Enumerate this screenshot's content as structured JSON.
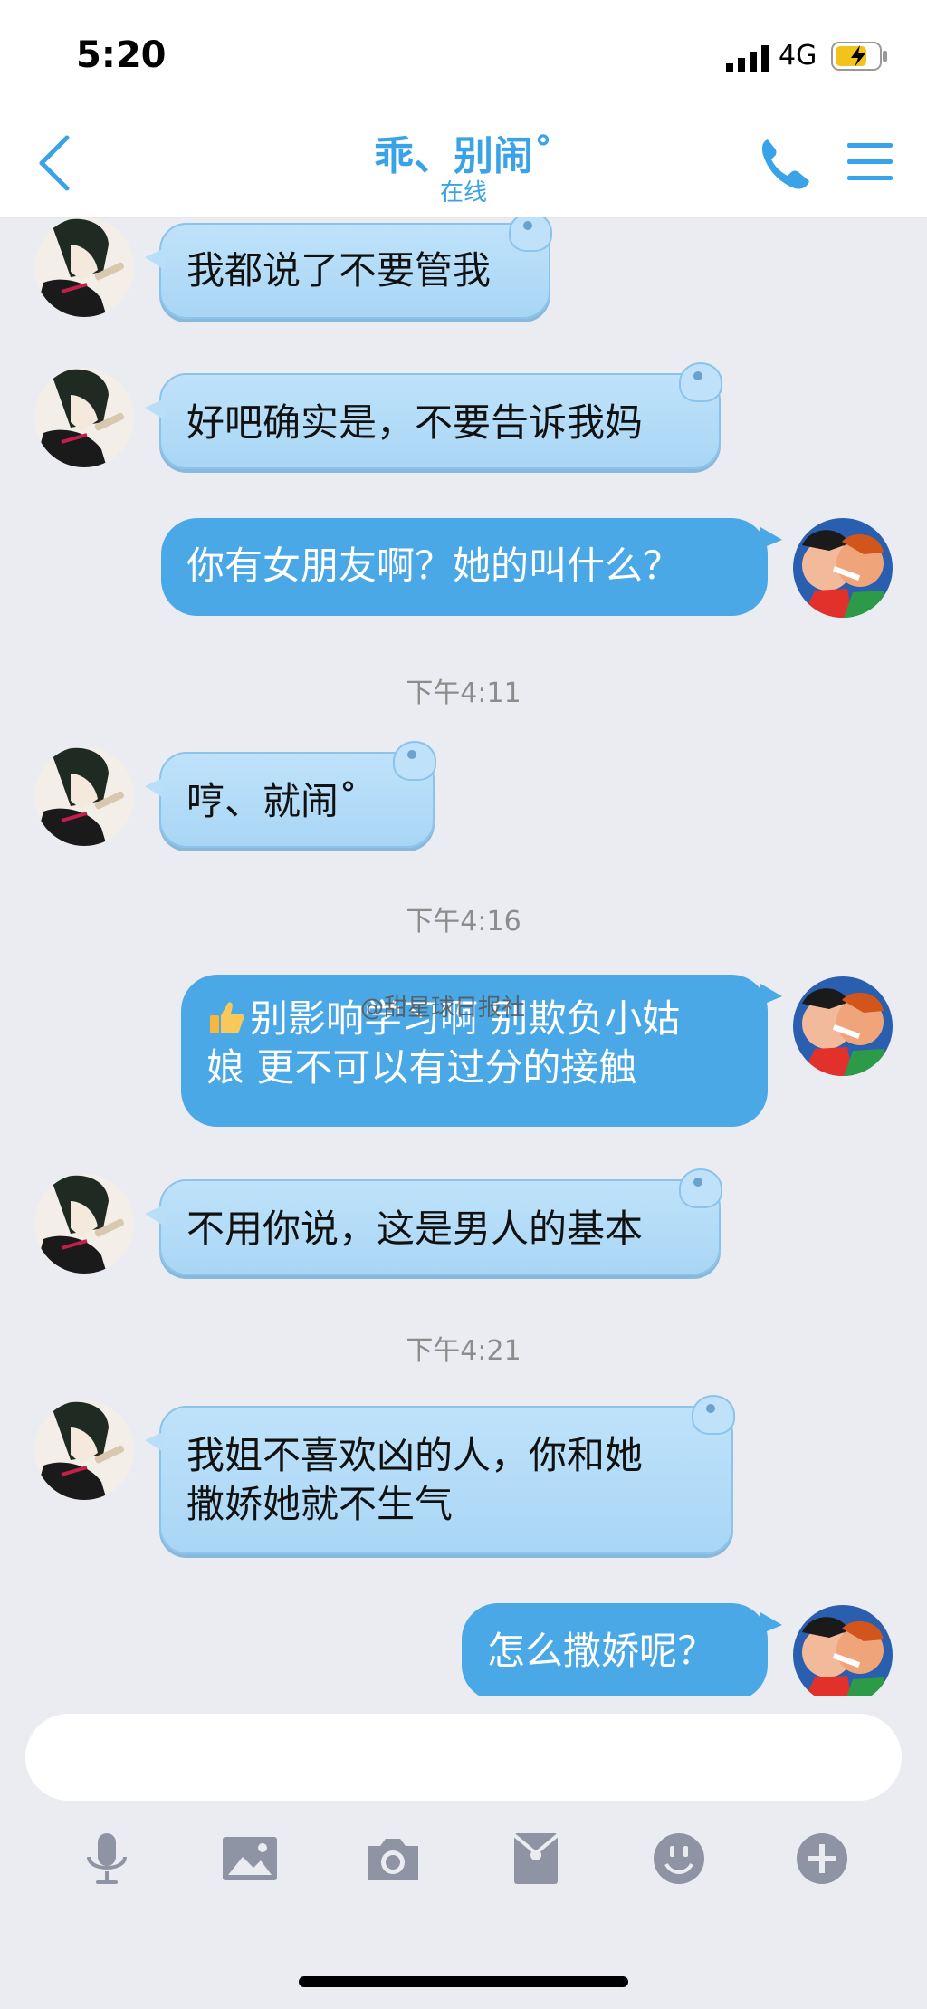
{
  "status": {
    "time": "5:20",
    "network": "4G"
  },
  "header": {
    "title": "乖、别闹˚",
    "subtitle": "在线"
  },
  "messages": [
    {
      "side": "in",
      "text": "我都说了不要管我"
    },
    {
      "side": "in",
      "text": "好吧确实是，不要告诉我妈"
    },
    {
      "side": "out",
      "text": "你有女朋友啊？她的叫什么？"
    },
    {
      "side": "ts",
      "text": "下午4:11"
    },
    {
      "side": "in",
      "text": "哼、就闹˚"
    },
    {
      "side": "ts",
      "text": "下午4:16"
    },
    {
      "side": "out",
      "line1": "别影响学习啊 别欺负小姑",
      "line2": "娘 更不可以有过分的接触"
    },
    {
      "side": "in",
      "text": "不用你说，这是男人的基本"
    },
    {
      "side": "ts",
      "text": "下午4:21"
    },
    {
      "side": "in",
      "line1": "我姐不喜欢凶的人，你和她",
      "line2": "撒娇她就不生气"
    },
    {
      "side": "out",
      "text": "怎么撒娇呢？"
    }
  ],
  "watermark": "@甜星球日报社",
  "input": {
    "placeholder": ""
  },
  "toolbar": [
    "microphone-icon",
    "image-icon",
    "camera-icon",
    "red-packet-icon",
    "emoji-icon",
    "plus-icon"
  ],
  "colors": {
    "accent": "#3aa3e7",
    "bubble_out": "#4aa8e6",
    "bubble_in": "#bfe2fa",
    "background": "#eaecf1"
  }
}
